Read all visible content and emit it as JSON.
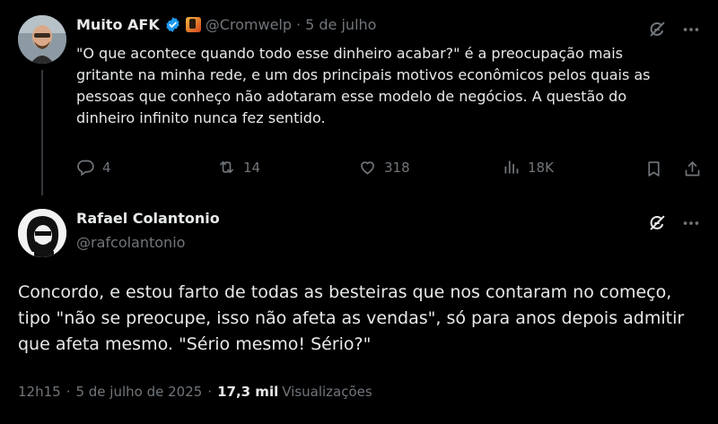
{
  "quoted_tweet": {
    "display_name": "Muito AFK",
    "handle": "@Cromwelp",
    "separator": "·",
    "date": "5 de julho",
    "text": "\"O que acontece quando todo esse dinheiro acabar?\" é a preocupação mais gritante na minha rede, e um dos principais motivos econômicos pelos quais as pessoas que conheço não adotaram esse modelo de negócios. A questão do dinheiro infinito nunca fez sentido.",
    "replies": "4",
    "reposts": "14",
    "likes": "318",
    "views": "18K",
    "verified_color": "#1d9bf0"
  },
  "main_tweet": {
    "display_name": "Rafael Colantonio",
    "handle": "@rafcolantonio",
    "text": "Concordo, e estou farto de todas as besteiras que nos contaram no começo, tipo \"não se preocupe, isso não afeta as vendas\", só para anos depois admitir que afeta mesmo. \"Sério mesmo! Sério?\"",
    "time": "12h15",
    "meta_sep_1": "·",
    "date": "5 de julho de 2025",
    "meta_sep_2": "·",
    "views_count": "17,3 mil",
    "views_label": "Visualizações"
  },
  "icons": [
    "grok-icon",
    "more-icon",
    "reply-icon",
    "repost-icon",
    "like-icon",
    "views-icon",
    "bookmark-icon",
    "share-icon",
    "verified-badge-icon"
  ]
}
